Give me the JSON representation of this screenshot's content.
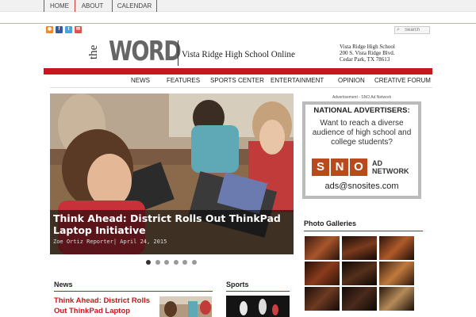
{
  "topnav": {
    "items": [
      {
        "label": "HOME"
      },
      {
        "label": "ABOUT"
      },
      {
        "label": "CALENDAR"
      }
    ]
  },
  "social": {
    "icons": [
      "rss-icon",
      "facebook-icon",
      "twitter-icon",
      "email-icon"
    ]
  },
  "search": {
    "placeholder": "Search"
  },
  "masthead": {
    "logo_the": "the",
    "logo_word": "WORD",
    "tagline": "Vista Ridge High School Online",
    "address": [
      "Vista Ridge High School",
      "200 S. Vista Ridge Blvd.",
      "Cedar Park, TX 78613"
    ]
  },
  "mainnav": {
    "items": [
      {
        "label": "NEWS"
      },
      {
        "label": "FEATURES"
      },
      {
        "label": "SPORTS CENTER"
      },
      {
        "label": "ENTERTAINMENT"
      },
      {
        "label": "OPINION"
      },
      {
        "label": "CREATIVE FORUM"
      }
    ]
  },
  "slider": {
    "title": "Think Ahead: District Rolls Out ThinkPad Laptop Initiative",
    "byline": "Zoe Ortiz Reporter| April 24, 2015",
    "dot_count": 6,
    "active_dot": 1
  },
  "ad": {
    "label": "Advertisement - SNO Ad Network",
    "headline": "NATIONAL ADVERTISERS:",
    "body": "Want to reach a diverse audience of high school and college students?",
    "sno_letters": [
      "S",
      "N",
      "O"
    ],
    "sno_line1": "AD",
    "sno_line2": "NETWORK",
    "email": "ads@snosites.com"
  },
  "galleries": {
    "title": "Photo Galleries"
  },
  "news": {
    "title": "News",
    "item_title": "Think Ahead: District Rolls Out ThinkPad Laptop"
  },
  "sports": {
    "title": "Sports"
  },
  "colors": {
    "accent": "#c7161c",
    "ad_orange": "#b94a1e"
  }
}
